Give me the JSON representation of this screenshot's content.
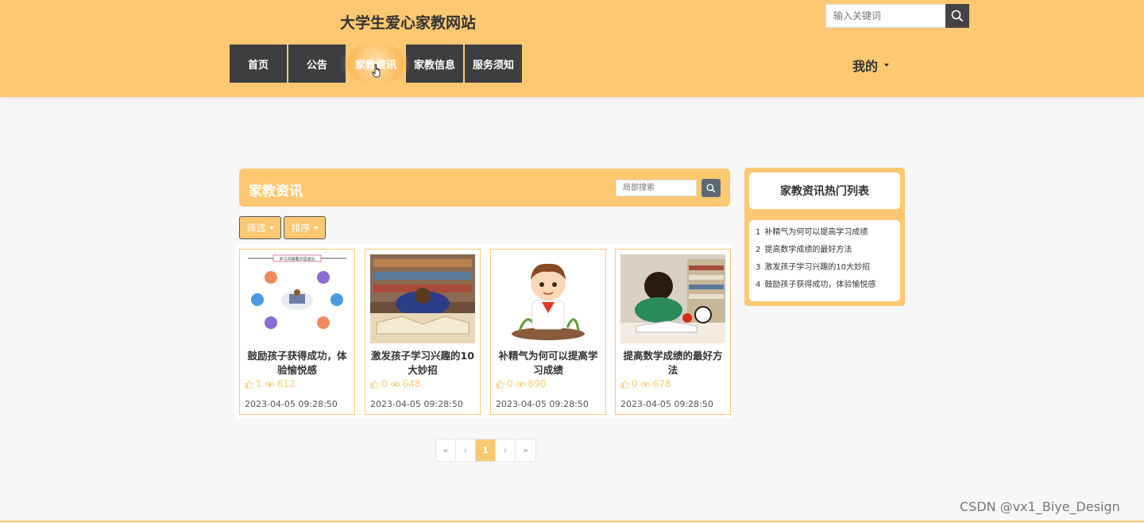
{
  "header": {
    "site_title": "大学生爱心家教网站",
    "search_placeholder": "输入关键词",
    "nav": [
      {
        "label": "首页"
      },
      {
        "label": "公告"
      },
      {
        "label": "家教资讯"
      },
      {
        "label": "家教信息"
      },
      {
        "label": "服务须知"
      }
    ],
    "user_menu": "我的"
  },
  "main": {
    "title": "家教资讯",
    "local_search_placeholder": "局部搜索",
    "filter_label": "筛选",
    "sort_label": "排序",
    "cards": [
      {
        "title": "鼓励孩子获得成功，体验愉悦感",
        "likes": "1",
        "views": "612",
        "date": "2023-04-05 09:28:50",
        "thumb_caption": "学习问题要对症成长"
      },
      {
        "title": "激发孩子学习兴趣的10大妙招",
        "likes": "0",
        "views": "648",
        "date": "2023-04-05 09:28:50"
      },
      {
        "title": "补精气为何可以提高学习成绩",
        "likes": "0",
        "views": "690",
        "date": "2023-04-05 09:28:50"
      },
      {
        "title": "提高数学成绩的最好方法",
        "likes": "0",
        "views": "678",
        "date": "2023-04-05 09:28:50"
      }
    ]
  },
  "pagination": {
    "first": "«",
    "prev": "‹",
    "current": "1",
    "next": "›",
    "last": "»"
  },
  "sidebar": {
    "title": "家教资讯热门列表",
    "items": [
      {
        "num": "1",
        "text": "补精气为何可以提高学习成绩"
      },
      {
        "num": "2",
        "text": "提高数学成绩的最好方法"
      },
      {
        "num": "3",
        "text": "激发孩子学习兴趣的10大妙招"
      },
      {
        "num": "4",
        "text": "鼓励孩子获得成功，体验愉悦感"
      }
    ]
  },
  "watermark": "CSDN @vx1_Biye_Design",
  "colors": {
    "accent": "#fec872",
    "nav_bg": "#3e3e40",
    "page_bg": "#f7f7f7"
  }
}
